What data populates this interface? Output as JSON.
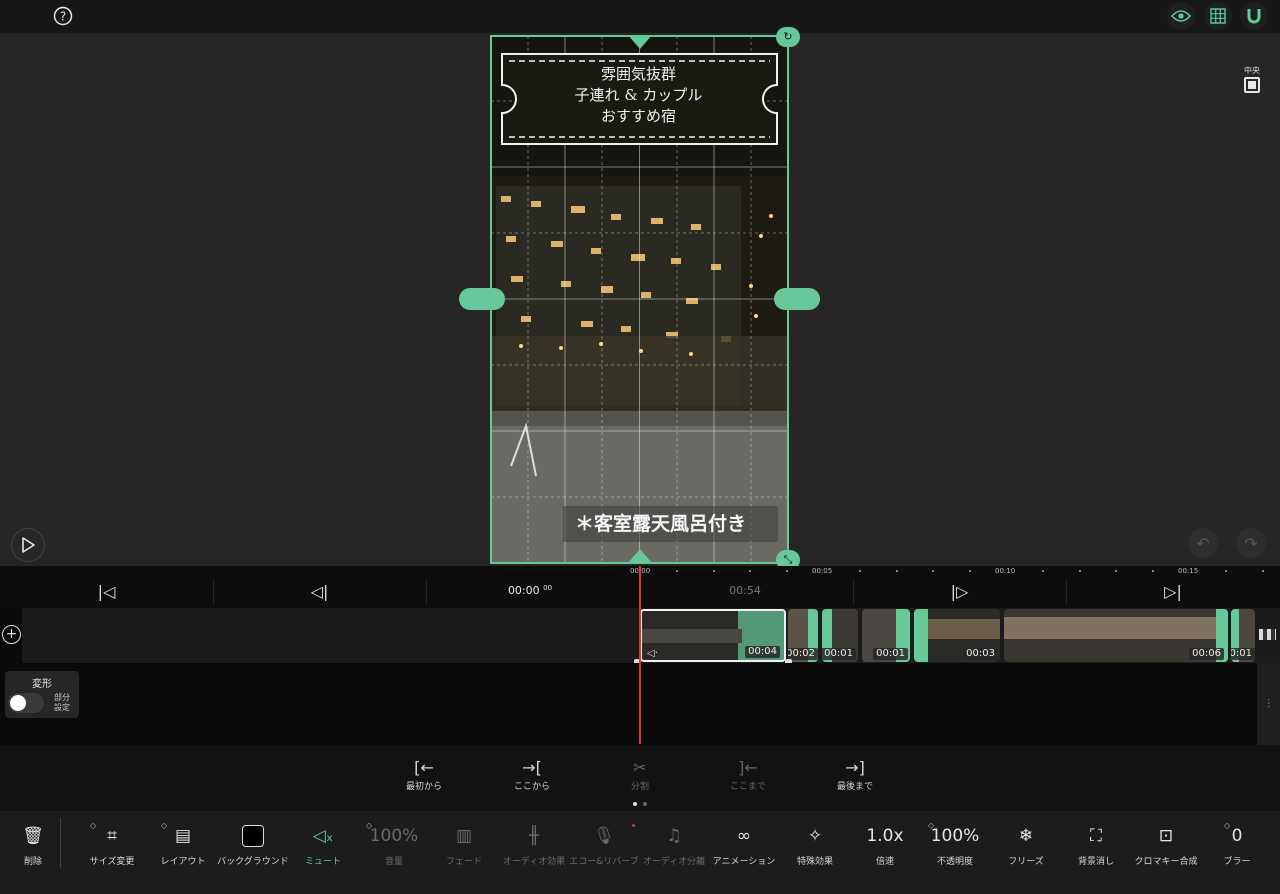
{
  "topbar": {
    "help_icon": "help-icon",
    "eye_icon": "eye-icon",
    "grid_icon": "grid-icon",
    "magnet_icon": "magnet-icon"
  },
  "preview": {
    "ticket_lines": [
      "雰囲気抜群",
      "子連れ & カップル",
      "おすすめ宿"
    ],
    "caption": "＊客室露天風呂付き",
    "center_label": "中央"
  },
  "ruler": {
    "labels": [
      "00:00",
      "00:05",
      "00:10",
      "00:15"
    ]
  },
  "timeline_nav": {
    "current_time": "00:00",
    "current_frames": "00",
    "total_time": "00:54"
  },
  "clips": [
    {
      "duration": "00:04"
    },
    {
      "duration": "00:02"
    },
    {
      "duration": "00:01"
    },
    {
      "duration": "00:01"
    },
    {
      "duration": "00:03"
    },
    {
      "duration": "00:06"
    },
    {
      "duration": "00:01"
    }
  ],
  "transform_panel": {
    "title": "変形",
    "toggle_label_1": "部分",
    "toggle_label_2": "設定",
    "enabled": false
  },
  "subtools": [
    {
      "label": "最初から",
      "icon": "trim-start-icon"
    },
    {
      "label": "ここから",
      "icon": "from-here-icon"
    },
    {
      "label": "分割",
      "icon": "split-icon"
    },
    {
      "label": "ここまで",
      "icon": "to-here-icon"
    },
    {
      "label": "最後まで",
      "icon": "trim-end-icon"
    }
  ],
  "toolbar": {
    "delete": "削除",
    "resize": "サイズ変更",
    "layout": "レイアウト",
    "background": "バックグラウンド",
    "mute": "ミュート",
    "volume_value": "100%",
    "volume": "音量",
    "fade": "フェード",
    "audio_effect": "オーディオ効果",
    "echo": "エコー&リバーブ",
    "audio_split": "オーディオ分離",
    "animation": "アニメーション",
    "special_effects": "特殊効果",
    "speed_value": "1.0x",
    "speed": "倍速",
    "opacity_value": "100%",
    "opacity": "不透明度",
    "freeze": "フリーズ",
    "bg_remove": "背景消し",
    "chroma": "クロマキー合成",
    "blur_value": "0",
    "blur": "ブラー"
  },
  "colors": {
    "accent": "#67c99a",
    "playhead": "#e0313a"
  }
}
